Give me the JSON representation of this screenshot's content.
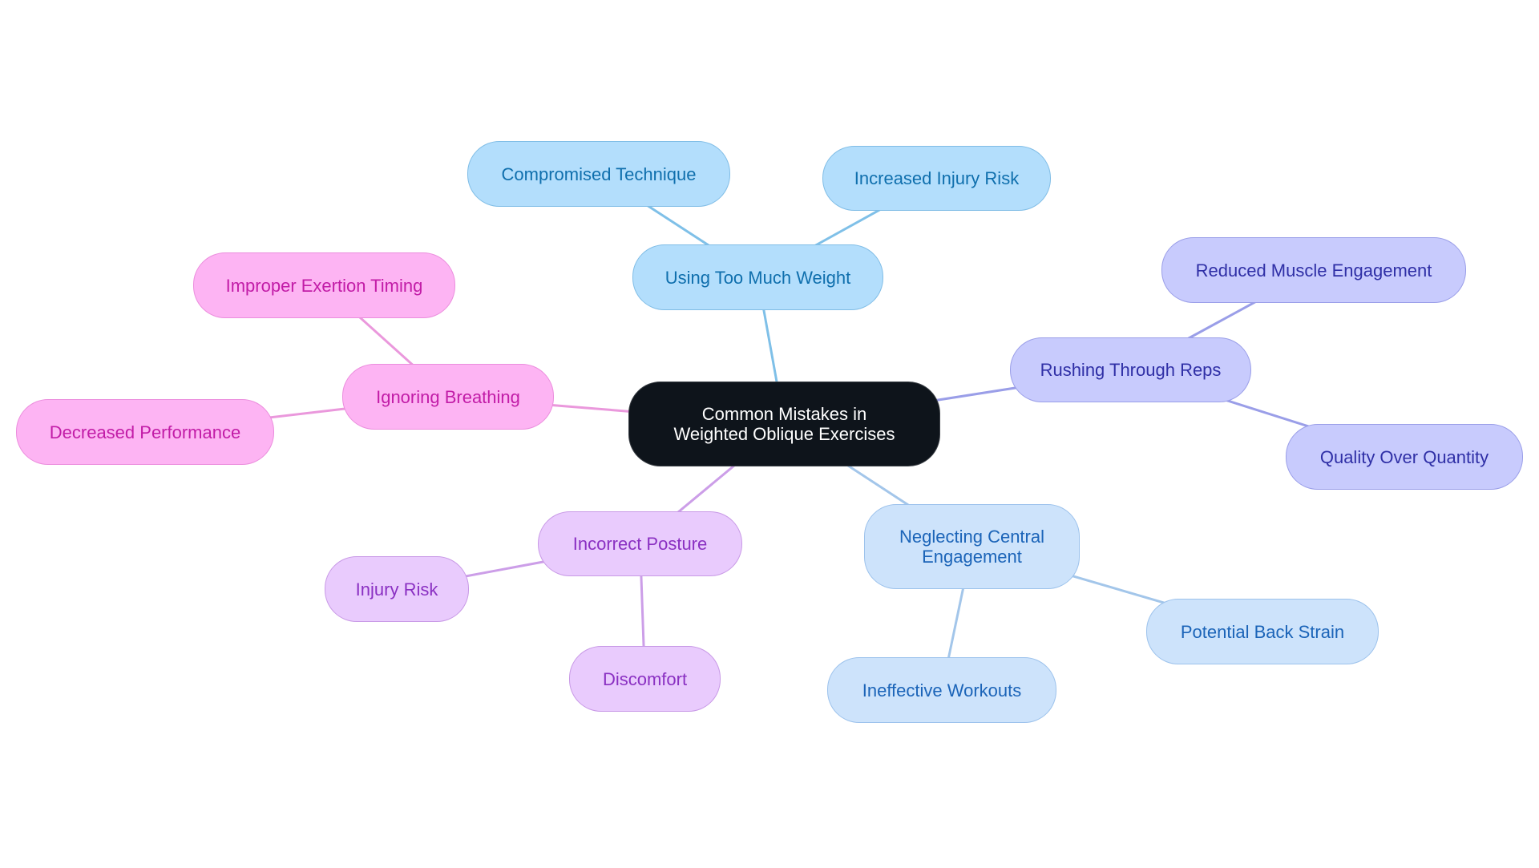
{
  "diagram": {
    "type": "mind-map",
    "root": {
      "id": "root",
      "label": "Common Mistakes in Weighted Oblique Exercises"
    },
    "branches": [
      {
        "id": "weight",
        "label": "Using Too Much Weight",
        "color_theme": "blue",
        "edge_color": "#7fc0e8",
        "children": [
          {
            "id": "weight-1",
            "label": "Compromised Technique"
          },
          {
            "id": "weight-2",
            "label": "Increased Injury Risk"
          }
        ]
      },
      {
        "id": "reps",
        "label": "Rushing Through Reps",
        "color_theme": "indigo",
        "edge_color": "#9a9ee8",
        "children": [
          {
            "id": "reps-1",
            "label": "Reduced Muscle Engagement"
          },
          {
            "id": "reps-2",
            "label": "Quality Over Quantity"
          }
        ]
      },
      {
        "id": "central",
        "label": "Neglecting Central Engagement",
        "color_theme": "sky",
        "edge_color": "#a3c6ea",
        "children": [
          {
            "id": "central-1",
            "label": "Potential Back Strain"
          },
          {
            "id": "central-2",
            "label": "Ineffective Workouts"
          }
        ]
      },
      {
        "id": "posture",
        "label": "Incorrect Posture",
        "color_theme": "violet",
        "edge_color": "#cc9ee8",
        "children": [
          {
            "id": "posture-1",
            "label": "Injury Risk"
          },
          {
            "id": "posture-2",
            "label": "Discomfort"
          }
        ]
      },
      {
        "id": "breathing",
        "label": "Ignoring Breathing",
        "color_theme": "pink",
        "edge_color": "#ea98dc",
        "children": [
          {
            "id": "breathing-1",
            "label": "Improper Exertion Timing"
          },
          {
            "id": "breathing-2",
            "label": "Decreased Performance"
          }
        ]
      }
    ]
  },
  "labels": {
    "root": "Common Mistakes in Weighted Oblique Exercises",
    "weight": "Using Too Much Weight",
    "weight_1": "Compromised Technique",
    "weight_2": "Increased Injury Risk",
    "reps": "Rushing Through Reps",
    "reps_1": "Reduced Muscle Engagement",
    "reps_2": "Quality Over Quantity",
    "central": "Neglecting Central Engagement",
    "central_1": "Potential Back Strain",
    "central_2": "Ineffective Workouts",
    "posture": "Incorrect Posture",
    "posture_1": "Injury Risk",
    "posture_2": "Discomfort",
    "breathing": "Ignoring Breathing",
    "breathing_1": "Improper Exertion Timing",
    "breathing_2": "Decreased Performance"
  },
  "colors": {
    "blue": "#7fc0e8",
    "indigo": "#9a9ee8",
    "sky": "#a3c6ea",
    "violet": "#cc9ee8",
    "pink": "#ea98dc",
    "root_fill": "#0e141b"
  }
}
